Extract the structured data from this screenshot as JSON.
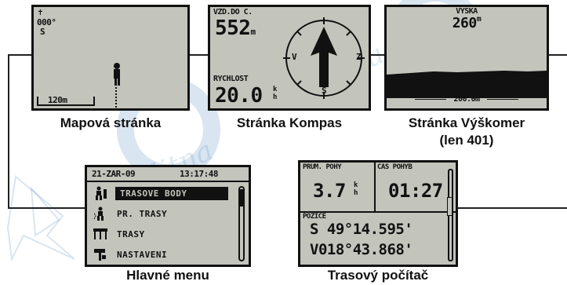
{
  "captions": {
    "map": "Mapová stránka",
    "compass": "Stránka Kompas",
    "altimeter_line1": "Stránka Výškomer",
    "altimeter_line2": "(len 401)",
    "menu": "Hlavné menu",
    "trip": "Trasový počítač"
  },
  "map_page": {
    "heading": "000°",
    "direction": "S",
    "scale": "120m"
  },
  "compass_page": {
    "distance_label": "VZD.DO C.",
    "distance_value": "552",
    "distance_unit": "m",
    "speed_label": "RYCHLOST",
    "speed_value": "20.0",
    "speed_unit_top": "k",
    "speed_unit_bottom": "h",
    "dial_labels": {
      "west": "V",
      "east": "Z",
      "south": "S"
    }
  },
  "altimeter_page": {
    "label": "VYSKA",
    "value": "260",
    "unit": "m",
    "scale": "200.0m"
  },
  "menu_page": {
    "date": "21-ZAR-09",
    "time": "13:17:48",
    "items": [
      {
        "label": "TRASOVE BODY",
        "icon": "walking-person-icon",
        "selected": true
      },
      {
        "label": "PR. TRASY",
        "icon": "track-person-icon",
        "selected": false
      },
      {
        "label": "TRASY",
        "icon": "routes-icon",
        "selected": false
      },
      {
        "label": "NASTAVENI",
        "icon": "settings-icon",
        "selected": false
      }
    ]
  },
  "trip_page": {
    "avg_label": "PRUM. POHY",
    "avg_value": "3.7",
    "avg_unit_top": "k",
    "avg_unit_bottom": "h",
    "time_label": "CAS POHYB",
    "time_value": "01:27",
    "position_label": "POZICE",
    "lat": "S 49°14.595'",
    "lon": "V018°43.868'"
  },
  "colors": {
    "screen_bg": "#c3c4bc",
    "watermark": "#2a6fb0"
  }
}
